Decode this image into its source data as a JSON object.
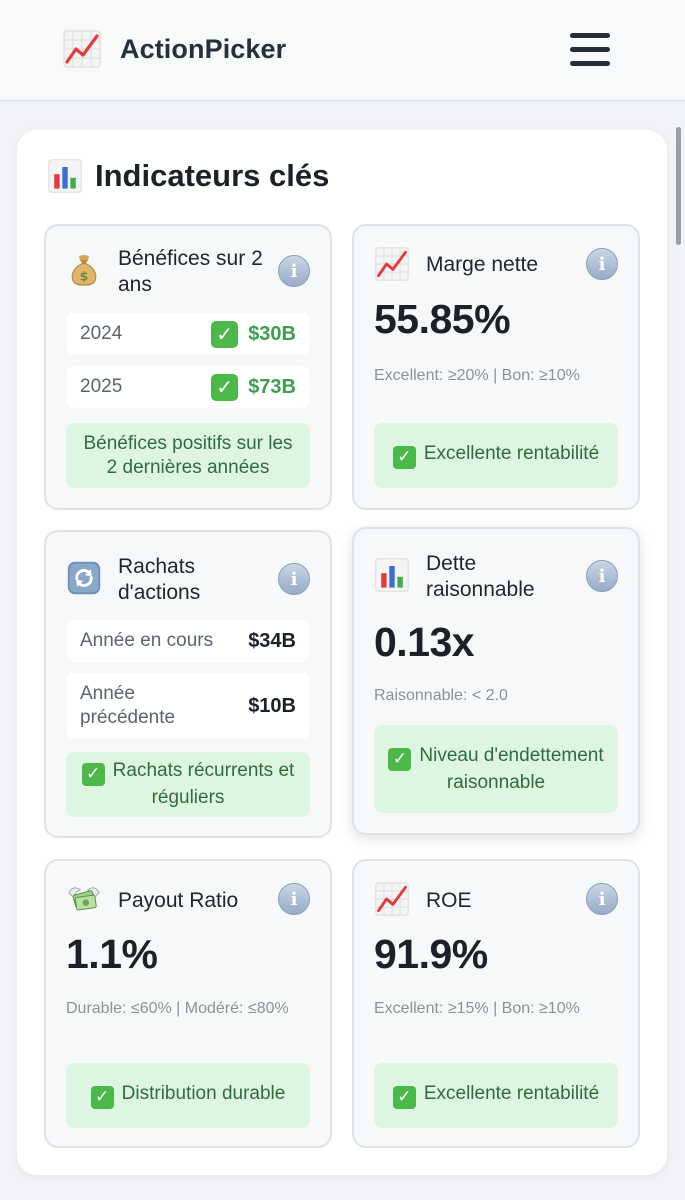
{
  "app": {
    "name": "ActionPicker",
    "logo_icon": "chart-increasing-icon",
    "menu_icon": "hamburger-menu-icon"
  },
  "section": {
    "title": "Indicateurs clés",
    "icon": "bar-chart-icon"
  },
  "colors": {
    "accent_green": "#3f9d4f",
    "verdict_bg": "#def5e1",
    "verdict_text": "#2f6d3c",
    "check_green": "#4cb84a"
  },
  "cards": {
    "benefices": {
      "icon": "money-bag-icon",
      "title": "Bénéfices sur 2 ans",
      "rows": [
        {
          "label": "2024",
          "value": "$30B"
        },
        {
          "label": "2025",
          "value": "$73B"
        }
      ],
      "verdict": "Bénéfices positifs sur les 2 dernières années"
    },
    "marge": {
      "icon": "chart-increasing-icon",
      "title": "Marge nette",
      "value": "55.85%",
      "threshold": "Excellent: ≥20% | Bon: ≥10%",
      "verdict": "Excellente rentabilité"
    },
    "rachats": {
      "icon": "repeat-arrows-icon",
      "title": "Rachats d'actions",
      "rows": [
        {
          "label": "Année en cours",
          "value": "$34B"
        },
        {
          "label": "Année précédente",
          "value": "$10B"
        }
      ],
      "verdict": "Rachats récurrents et réguliers"
    },
    "dette": {
      "icon": "bar-chart-icon",
      "title": "Dette raisonnable",
      "value": "0.13x",
      "threshold": "Raisonnable: < 2.0",
      "verdict": "Niveau d'endettement raisonnable"
    },
    "payout": {
      "icon": "money-with-wings-icon",
      "title": "Payout Ratio",
      "value": "1.1%",
      "threshold": "Durable: ≤60% | Modéré: ≤80%",
      "verdict": "Distribution durable"
    },
    "roe": {
      "icon": "chart-increasing-icon",
      "title": "ROE",
      "value": "91.9%",
      "threshold": "Excellent: ≥15% | Bon: ≥10%",
      "verdict": "Excellente rentabilité"
    }
  }
}
